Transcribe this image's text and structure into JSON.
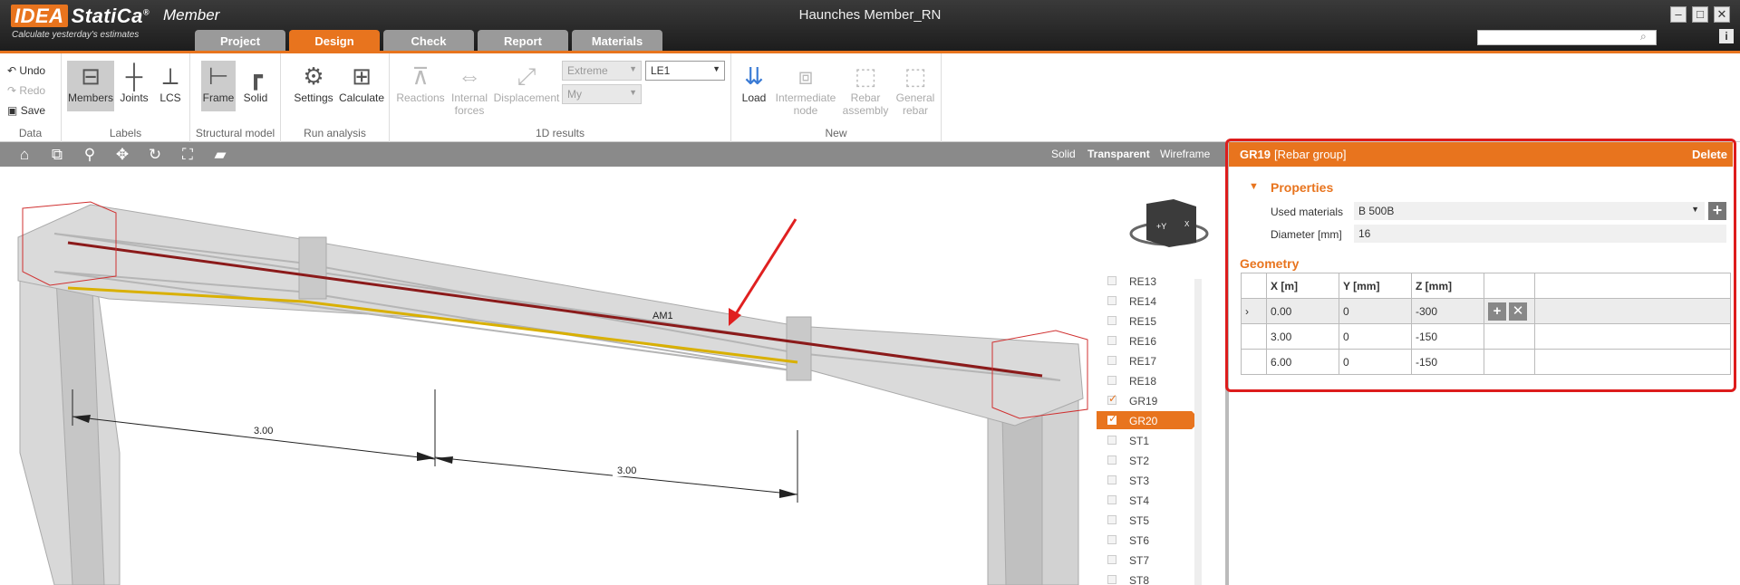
{
  "app": {
    "logo_brand": "IDEA",
    "logo_name": "StatiCa",
    "logo_reg": "®",
    "product": "Member",
    "tagline": "Calculate yesterday's estimates",
    "window_title": "Haunches Member_RN",
    "minimize_icon": "minimize-icon",
    "maximize_icon": "maximize-icon",
    "close_icon": "close-icon",
    "info_label": "i"
  },
  "tabs": [
    {
      "label": "Project"
    },
    {
      "label": "Design",
      "active": true
    },
    {
      "label": "Check"
    },
    {
      "label": "Report"
    },
    {
      "label": "Materials"
    }
  ],
  "ribbon": {
    "data": {
      "group": "Data",
      "undo": "Undo",
      "redo": "Redo",
      "save": "Save"
    },
    "labels": {
      "group": "Labels",
      "members": "Members",
      "joints": "Joints",
      "lcs": "LCS"
    },
    "structural": {
      "group": "Structural model",
      "frame": "Frame",
      "solid": "Solid"
    },
    "run": {
      "group": "Run analysis",
      "settings": "Settings",
      "calculate": "Calculate"
    },
    "results": {
      "group": "1D results",
      "reactions": "Reactions",
      "internal_1": "Internal",
      "internal_2": "forces",
      "displacement": "Displacement",
      "dd_extreme": "Extreme",
      "dd_my": "My",
      "dd_le": "LE1"
    },
    "new": {
      "group": "New",
      "load": "Load",
      "node_1": "Intermediate",
      "node_2": "node",
      "rebar_1": "Rebar",
      "rebar_2": "assembly",
      "general_1": "General",
      "general_2": "rebar"
    }
  },
  "view_modes": {
    "solid": "Solid",
    "transparent": "Transparent",
    "wireframe": "Wireframe",
    "active": "Transparent"
  },
  "viewport": {
    "member_label": "AM1",
    "dim1": "3.00",
    "dim2": "3.00",
    "cube_label": "+Y",
    "cube_side": "X"
  },
  "item_list": [
    {
      "label": "RE13",
      "checked": false
    },
    {
      "label": "RE14",
      "checked": false
    },
    {
      "label": "RE15",
      "checked": false
    },
    {
      "label": "RE16",
      "checked": false
    },
    {
      "label": "RE17",
      "checked": false
    },
    {
      "label": "RE18",
      "checked": false
    },
    {
      "label": "GR19",
      "checked": true
    },
    {
      "label": "GR20",
      "checked": true,
      "selected": true
    },
    {
      "label": "ST1",
      "checked": false
    },
    {
      "label": "ST2",
      "checked": false
    },
    {
      "label": "ST3",
      "checked": false
    },
    {
      "label": "ST4",
      "checked": false
    },
    {
      "label": "ST5",
      "checked": false
    },
    {
      "label": "ST6",
      "checked": false
    },
    {
      "label": "ST7",
      "checked": false
    },
    {
      "label": "ST8",
      "checked": false
    }
  ],
  "panel": {
    "id": "GR19",
    "type": "[Rebar group]",
    "delete": "Delete",
    "properties_title": "Properties",
    "used_materials_label": "Used materials",
    "used_materials_value": "B 500B",
    "diameter_label": "Diameter [mm]",
    "diameter_value": "16",
    "geometry_title": "Geometry",
    "columns": [
      "X [m]",
      "Y [mm]",
      "Z [mm]"
    ],
    "rows": [
      [
        "0.00",
        "0",
        "-300"
      ],
      [
        "3.00",
        "0",
        "-150"
      ],
      [
        "6.00",
        "0",
        "-150"
      ]
    ]
  },
  "colors": {
    "accent": "#e8741e",
    "highlight_frame": "#dd1c1c",
    "rebar_red": "#8b1a1a",
    "rebar_yellow": "#d9b000"
  }
}
